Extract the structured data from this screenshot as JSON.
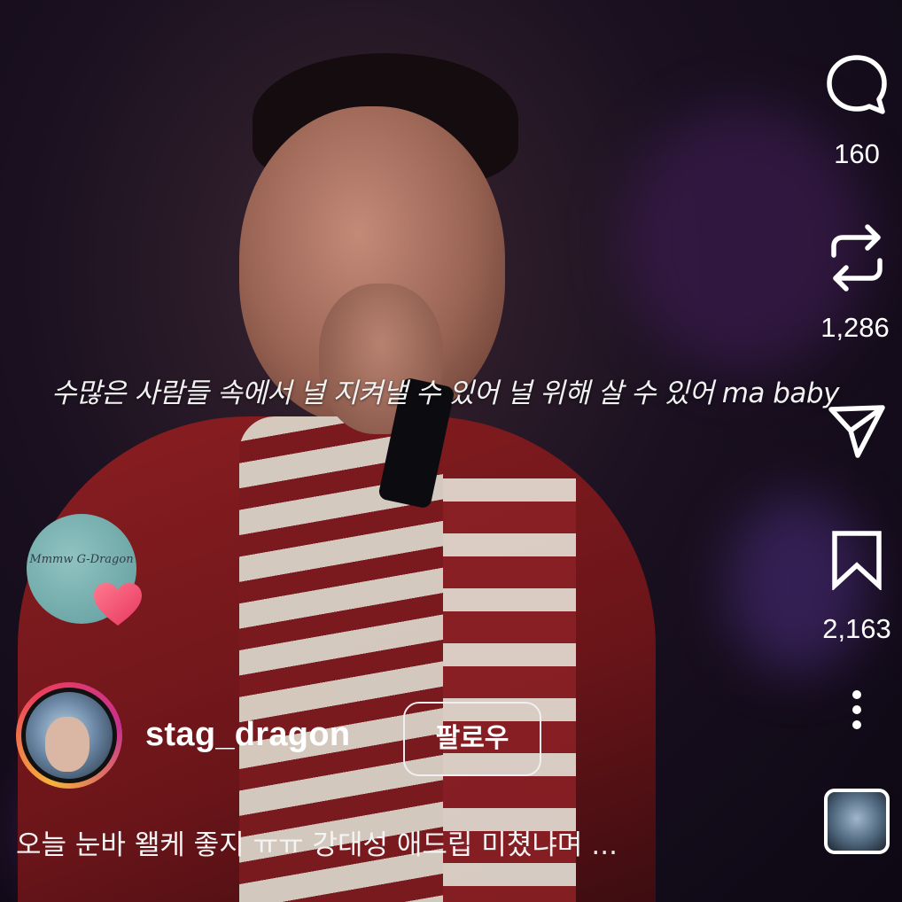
{
  "subtitle": "수많은 사람들 속에서 널 지켜낼 수 있어 널 위해 살 수 있어 ma baby",
  "rail": {
    "comments_count": "160",
    "reposts_count": "1,286",
    "saves_count": "2,163"
  },
  "music_badge": {
    "script_text": "Mmmw G-Dragon"
  },
  "user": {
    "username": "stag_dragon",
    "follow_label": "팔로우"
  },
  "caption": {
    "text": "오늘 눈바 왤케 좋지 ㅠㅠ 강대성 애드립 미쳤냐며",
    "more": "..."
  },
  "icons": {
    "comment": "comment-icon",
    "repost": "repost-icon",
    "share": "send-icon",
    "save": "bookmark-icon",
    "more": "more-vertical-icon",
    "heart": "heart-icon"
  },
  "colors": {
    "avatar_ring_start": "#f5b23a",
    "avatar_ring_end": "#c6318f",
    "heart": "#f05a7e"
  }
}
